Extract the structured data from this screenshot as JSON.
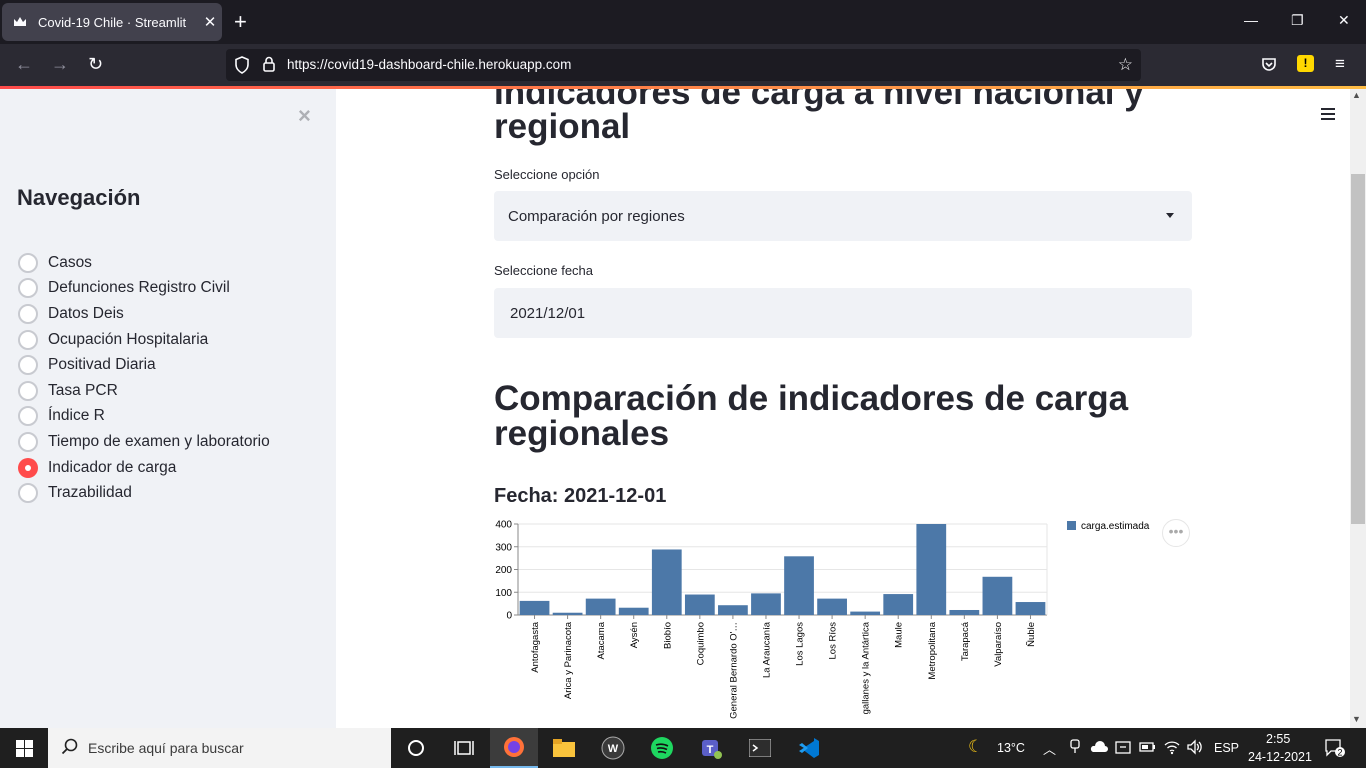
{
  "browser": {
    "tab_title": "Covid-19 Chile · Streamlit",
    "url": "https://covid19-dashboard-chile.herokuapp.com"
  },
  "sidebar": {
    "title": "Navegación",
    "items": [
      {
        "label": "Casos",
        "selected": false
      },
      {
        "label": "Defunciones Registro Civil",
        "selected": false
      },
      {
        "label": "Datos Deis",
        "selected": false
      },
      {
        "label": "Ocupación Hospitalaria",
        "selected": false
      },
      {
        "label": "Positivad Diaria",
        "selected": false
      },
      {
        "label": "Tasa PCR",
        "selected": false
      },
      {
        "label": "Índice R",
        "selected": false
      },
      {
        "label": "Tiempo de examen y laboratorio",
        "selected": false
      },
      {
        "label": "Indicador de carga",
        "selected": true
      },
      {
        "label": "Trazabilidad",
        "selected": false
      }
    ]
  },
  "main": {
    "heading1_line1": "Indicadores de carga a nivel nacional y",
    "heading1_line2": "regional",
    "select_option_label": "Seleccione opción",
    "select_option_value": "Comparación por regiones",
    "select_date_label": "Seleccione fecha",
    "select_date_value": "2021/12/01",
    "heading2_line1": "Comparación de indicadores de carga",
    "heading2_line2": "regionales",
    "subheading": "Fecha: 2021-12-01"
  },
  "chart_data": {
    "type": "bar",
    "categories": [
      "Antofagasta",
      "Arica y Parinacota",
      "Atacama",
      "Aysén",
      "Biobío",
      "Coquimbo",
      "General Bernardo O'…",
      "La Araucanía",
      "Los Lagos",
      "Los Ríos",
      "gallanes y la Antártica",
      "Maule",
      "Metropolitana",
      "Tarapacá",
      "Valparaíso",
      "Ñuble"
    ],
    "series": [
      {
        "name": "carga.estimada",
        "values": [
          62,
          10,
          72,
          32,
          288,
          90,
          43,
          95,
          258,
          72,
          15,
          92,
          400,
          22,
          168,
          57
        ]
      }
    ],
    "ylim": [
      0,
      400
    ],
    "yticks": [
      0,
      100,
      200,
      300,
      400
    ],
    "grid": true,
    "legend": "right",
    "color": "#4c78a8"
  },
  "taskbar": {
    "search_placeholder": "Escribe aquí para buscar",
    "weather": "13°C",
    "lang": "ESP",
    "time": "2:55",
    "date": "24-12-2021",
    "notifications": "2"
  }
}
